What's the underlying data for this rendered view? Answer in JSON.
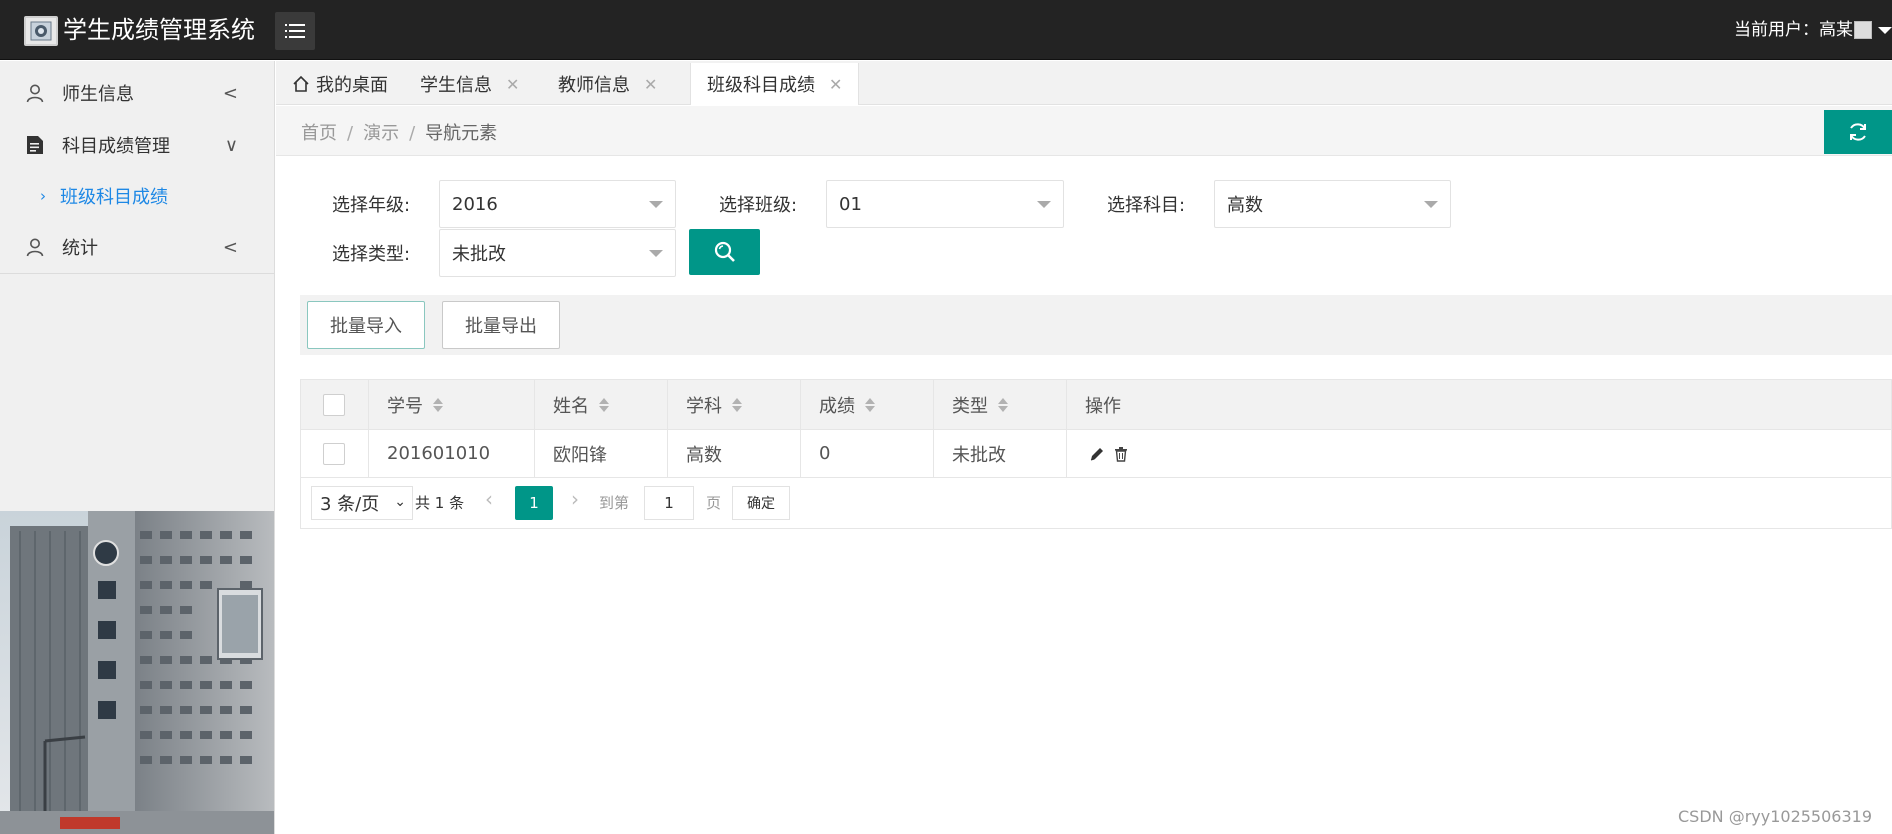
{
  "header": {
    "title": "学生成绩管理系统",
    "logo_icon": "school-emblem-icon",
    "menu_icon": "hamburger-icon",
    "user_label": "当前用户：高某"
  },
  "sidebar": {
    "items": [
      {
        "label": "师生信息",
        "icon": "user-icon",
        "arrow": "<"
      },
      {
        "label": "科目成绩管理",
        "icon": "document-icon",
        "arrow": "∨"
      },
      {
        "label": "统计",
        "icon": "user-icon",
        "arrow": "<"
      }
    ],
    "sub_items": [
      {
        "label": "班级科目成绩",
        "chevron": "›"
      }
    ]
  },
  "tabs": [
    {
      "label": "我的桌面",
      "icon": "home-icon",
      "close": ""
    },
    {
      "label": "学生信息",
      "close": "✕"
    },
    {
      "label": "教师信息",
      "close": "✕"
    },
    {
      "label": "班级科目成绩",
      "close": "✕",
      "active": true
    }
  ],
  "breadcrumb": {
    "items": [
      "首页",
      "演示",
      "导航元素"
    ],
    "separator": "/"
  },
  "filters": {
    "grade_label": "选择年级:",
    "grade_value": "2016",
    "class_label": "选择班级:",
    "class_value": "01",
    "subject_label": "选择科目:",
    "subject_value": "高数",
    "type_label": "选择类型:",
    "type_value": "未批改"
  },
  "toolbar": {
    "import_label": "批量导入",
    "export_label": "批量导出"
  },
  "table": {
    "columns": [
      "学号",
      "姓名",
      "学科",
      "成绩",
      "类型",
      "操作"
    ],
    "rows": [
      {
        "id": "201601010",
        "name": "欧阳锋",
        "subject": "高数",
        "score": "0",
        "type": "未批改"
      }
    ]
  },
  "pagination": {
    "page_size": "3 条/页",
    "page_size_chevron": "⌄",
    "total": "共 1 条",
    "prev": "‹",
    "current": "1",
    "next": "›",
    "goto_label": "到第",
    "goto_value": "1",
    "page_unit": "页",
    "confirm": "确定"
  },
  "watermark": "CSDN @ryy1025506319",
  "colors": {
    "header_bg": "#232323",
    "accent": "#009688",
    "link": "#1e88e5",
    "sidebar_bg": "#f0f0f0"
  }
}
